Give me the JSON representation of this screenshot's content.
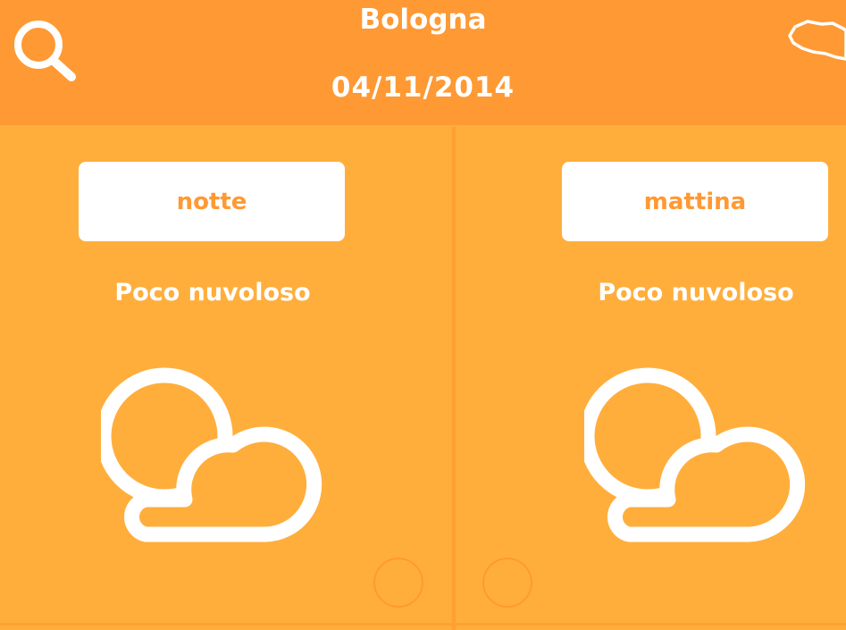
{
  "header": {
    "city": "Bologna",
    "date": "04/11/2014",
    "search_icon": "search-icon",
    "region_icon": "region-map-icon"
  },
  "panels": [
    {
      "slot_label": "notte",
      "condition": "Poco nuvoloso",
      "icon": "partly-cloudy-icon"
    },
    {
      "slot_label": "mattina",
      "condition": "Poco nuvoloso",
      "icon": "partly-cloudy-icon"
    }
  ],
  "colors": {
    "header": "#FF9933",
    "panel": "#FFAE3C",
    "button_bg": "#FFFFFF",
    "button_text": "#FF9933",
    "text": "#FFFFFF"
  }
}
